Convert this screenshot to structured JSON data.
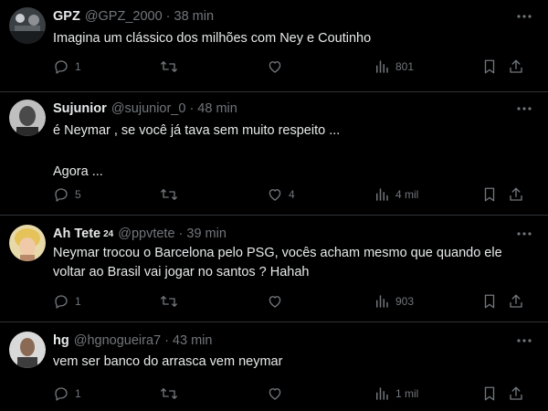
{
  "tweets": [
    {
      "name": "GPZ",
      "badge": "",
      "handle": "@GPZ_2000",
      "separator": "·",
      "time": "38 min",
      "lines": [
        "Imagina um clássico dos milhões com Ney e Coutinho"
      ],
      "replies": "1",
      "retweets": "",
      "likes": "",
      "views": "801"
    },
    {
      "name": "Sujunior",
      "badge": "",
      "handle": "@sujunior_0",
      "separator": "·",
      "time": "48 min",
      "lines": [
        "é Neymar , se você já tava sem muito respeito ...",
        "",
        "Agora ..."
      ],
      "replies": "5",
      "retweets": "",
      "likes": "4",
      "views": "4 mil"
    },
    {
      "name": "Ah Tete",
      "badge": "24",
      "handle": "@ppvtete",
      "separator": "·",
      "time": "39 min",
      "lines": [
        "Neymar trocou o Barcelona pelo PSG, vocês acham mesmo que quando ele",
        "voltar ao Brasil vai jogar no santos ? Hahah"
      ],
      "replies": "1",
      "retweets": "",
      "likes": "",
      "views": "903"
    },
    {
      "name": "hg",
      "badge": "",
      "handle": "@hgnogueira7",
      "separator": "·",
      "time": "43 min",
      "lines": [
        "vem ser banco do arrasca vem neymar"
      ],
      "replies": "1",
      "retweets": "",
      "likes": "",
      "views": "1 mil"
    }
  ],
  "icons": {
    "reply": "reply-icon",
    "retweet": "retweet-icon",
    "like": "like-icon",
    "views": "views-icon",
    "bookmark": "bookmark-icon",
    "share": "share-icon",
    "more": "more-icon"
  },
  "colors": {
    "background": "#000000",
    "text": "#e7e9ea",
    "secondary": "#71767b",
    "divider": "#2f3336"
  }
}
